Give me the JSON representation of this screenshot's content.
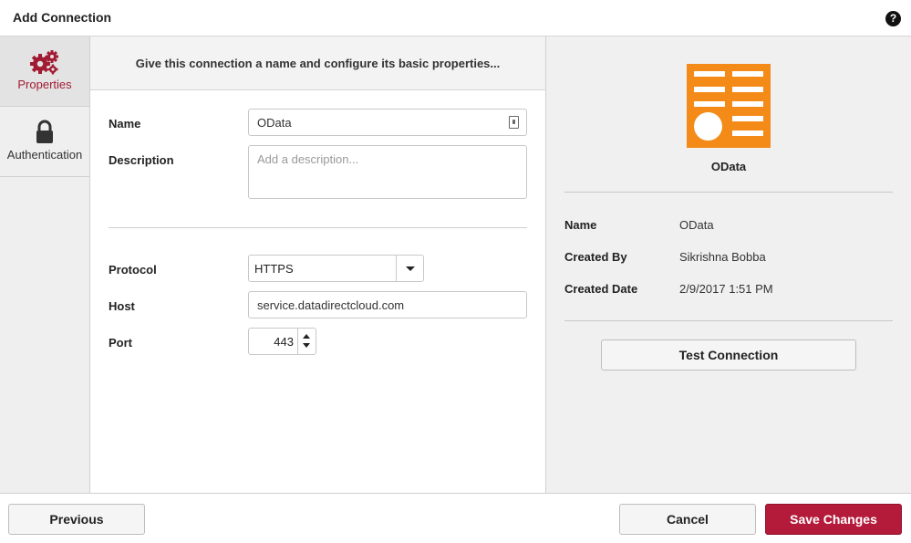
{
  "window": {
    "title": "Add Connection",
    "help_label": "?"
  },
  "sidenav": {
    "items": [
      {
        "label": "Properties",
        "icon": "gears-icon",
        "active": true
      },
      {
        "label": "Authentication",
        "icon": "lock-icon",
        "active": false
      }
    ]
  },
  "form": {
    "header": "Give this connection a name and configure its basic properties...",
    "name": {
      "label": "Name",
      "value": "OData"
    },
    "description": {
      "label": "Description",
      "placeholder": "Add a description..."
    },
    "protocol": {
      "label": "Protocol",
      "value": "HTTPS"
    },
    "host": {
      "label": "Host",
      "value": "service.datadirectcloud.com"
    },
    "port": {
      "label": "Port",
      "value": "443"
    }
  },
  "info": {
    "logo_caption": "OData",
    "rows": [
      {
        "label": "Name",
        "value": "OData"
      },
      {
        "label": "Created By",
        "value": "Sikrishna Bobba"
      },
      {
        "label": "Created Date",
        "value": "2/9/2017 1:51 PM"
      }
    ],
    "test_button": "Test Connection"
  },
  "footer": {
    "previous": "Previous",
    "cancel": "Cancel",
    "save": "Save Changes"
  },
  "colors": {
    "accent": "#b41a3a",
    "logo": "#f48a18"
  }
}
